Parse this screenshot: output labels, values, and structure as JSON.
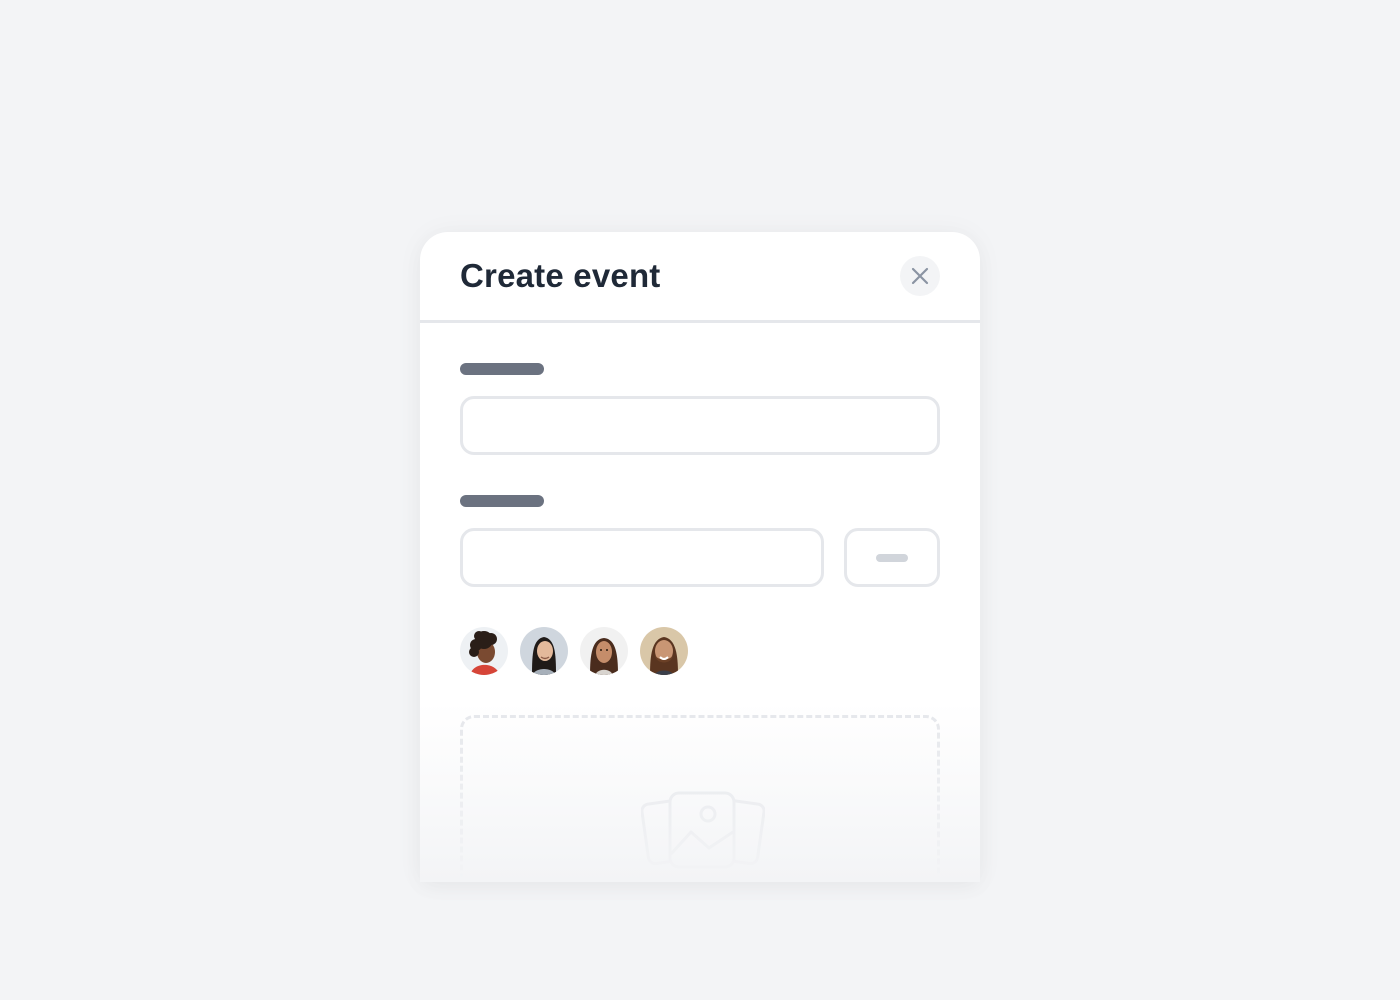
{
  "modal": {
    "title": "Create event",
    "close_icon": "close-icon"
  },
  "form": {
    "fields": [
      {
        "label": "",
        "value": "",
        "placeholder": ""
      },
      {
        "label": "",
        "value": "",
        "placeholder": ""
      }
    ],
    "stepper_icon": "minus-icon"
  },
  "attendees": [
    {
      "icon": "avatar-person-1"
    },
    {
      "icon": "avatar-person-2"
    },
    {
      "icon": "avatar-person-3"
    },
    {
      "icon": "avatar-person-4"
    }
  ],
  "dropzone": {
    "icon": "images-icon"
  },
  "colors": {
    "background": "#f3f4f6",
    "card": "#ffffff",
    "title": "#1f2937",
    "label_placeholder": "#6b7280",
    "border": "#e5e7eb",
    "icon": "#9ca3af"
  }
}
